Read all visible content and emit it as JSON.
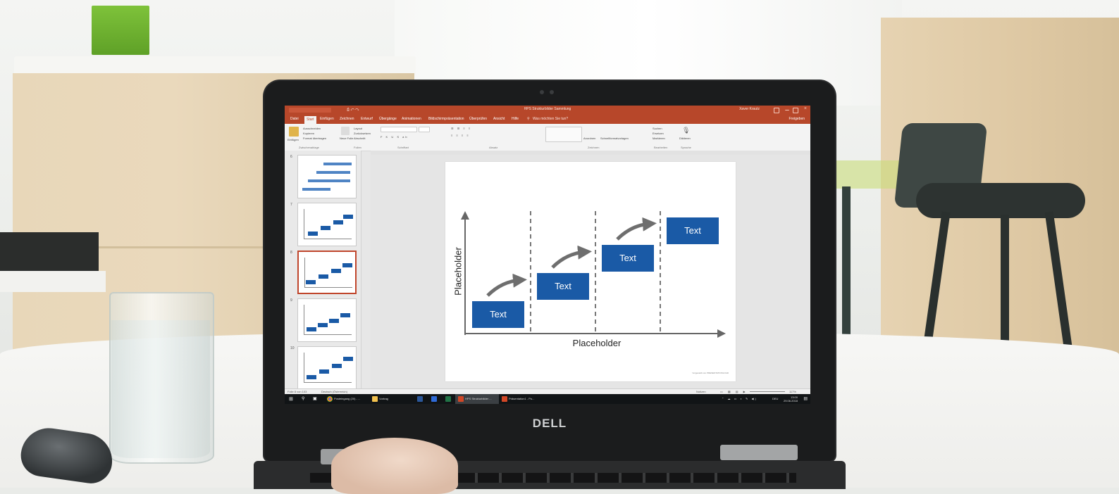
{
  "powerpoint": {
    "window_title": "HPS Strukturbilder Sammlung",
    "user": "Xaver Krautz",
    "tabs": [
      "Datei",
      "Start",
      "Einfügen",
      "Zeichnen",
      "Entwurf",
      "Übergänge",
      "Animationen",
      "Bildschirmpräsentation",
      "Überprüfen",
      "Ansicht",
      "Hilfe"
    ],
    "active_tab": "Start",
    "tell_me": "Was möchten Sie tun?",
    "share": "Freigeben",
    "ribbon": {
      "clipboard": {
        "paste": "Einfügen",
        "cut": "Ausschneiden",
        "copy": "Kopieren",
        "format_painter": "Format übertragen",
        "group": "Zwischenablage"
      },
      "slides": {
        "new_slide": "Neue Folie",
        "layout": "Layout",
        "reset": "Zurücksetzen",
        "section": "Abschnitt",
        "group": "Folien"
      },
      "font": {
        "group": "Schriftart"
      },
      "paragraph": {
        "group": "Absatz"
      },
      "drawing": {
        "arrange": "Anordnen",
        "quick_styles": "Schnellformatvorlagen",
        "group": "Zeichnen"
      },
      "editing": {
        "find": "Suchen",
        "replace": "Ersetzen",
        "select": "Markieren",
        "group": "Bearbeiten"
      },
      "voice": {
        "dictate": "Diktieren",
        "group": "Sprache"
      }
    },
    "slide_numbers": [
      "6",
      "7",
      "8",
      "9",
      "10"
    ],
    "selected_slide": "8",
    "slide": {
      "y_label": "Placeholder",
      "x_label": "Placeholder",
      "boxes": [
        "Text",
        "Text",
        "Text",
        "Text"
      ],
      "footer": "Vorgestellt von PRESENTATIONLOAD"
    },
    "status": {
      "slide_of": "Folie 8 von 103",
      "language": "Deutsch (Österreich)",
      "notes": "Notizen",
      "zoom": "117%"
    }
  },
  "taskbar": {
    "items": [
      "Posteingang (20) - ...",
      "Vortrag",
      "HPS Strukturbilder ...",
      "Präsentation1 - Po..."
    ],
    "active_item": "HPS Strukturbilder ...",
    "lang": "DEU",
    "time": "13:00",
    "date": "29.06.2018"
  },
  "laptop": {
    "brand": "DELL"
  },
  "colors": {
    "accent": "#b7472a",
    "box_blue": "#1a5aa6",
    "arrow_gray": "#6e6e6e"
  },
  "icons": [
    "windows-start-icon",
    "search-icon",
    "task-view-icon",
    "chrome-icon",
    "folder-icon",
    "word-icon",
    "excel-icon",
    "powerpoint-icon"
  ]
}
